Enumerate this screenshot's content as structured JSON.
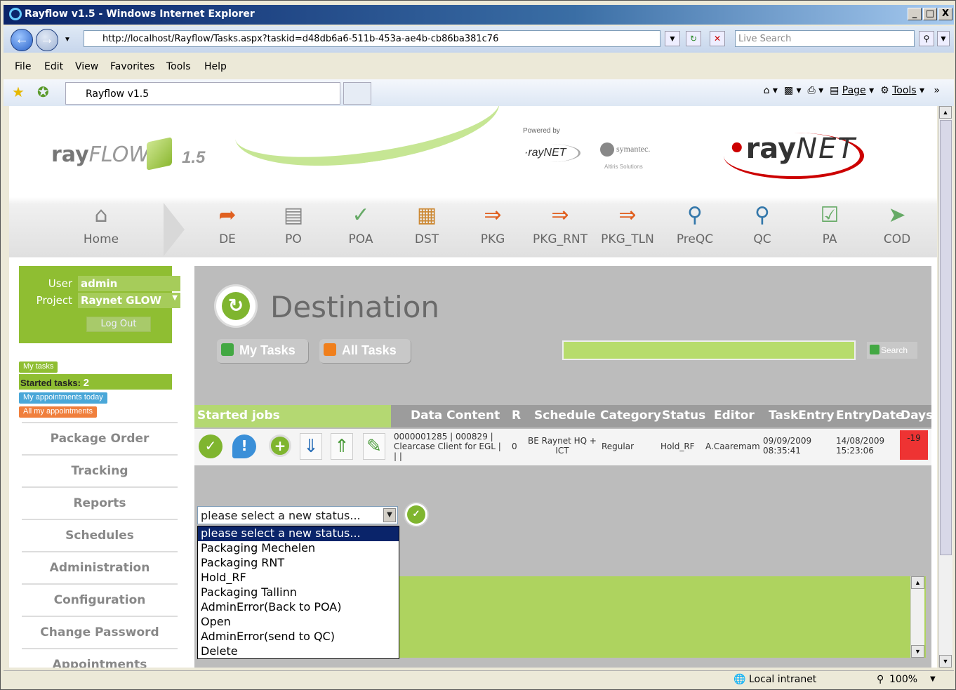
{
  "window": {
    "title": "Rayflow v1.5 - Windows Internet Explorer",
    "controls": [
      "_",
      "□",
      "X"
    ]
  },
  "addressbar": {
    "url": "http://localhost/Rayflow/Tasks.aspx?taskid=d48db6a6-511b-453a-ae4b-cb86ba381c76",
    "search_placeholder": "Live Search"
  },
  "menu": [
    "File",
    "Edit",
    "View",
    "Favorites",
    "Tools",
    "Help"
  ],
  "favbar": {
    "tab_label": "Rayflow v1.5",
    "page_label": "Page",
    "tools_label": "Tools"
  },
  "header": {
    "logo_ray": "ray",
    "logo_flow": "FLOW",
    "version": "1.5",
    "powered_by": "Powered by",
    "raynet_small": "·rayNET",
    "symantec": "symantec.",
    "altiris": "Altiris Solutions",
    "raynet_dot": "•",
    "raynet_ray": "ray",
    "raynet_net": "NET"
  },
  "nav": [
    {
      "label": "Home",
      "icon": "home-icon"
    },
    {
      "label": "DE",
      "icon": "import-icon"
    },
    {
      "label": "PO",
      "icon": "package-order-icon"
    },
    {
      "label": "POA",
      "icon": "approve-icon"
    },
    {
      "label": "DST",
      "icon": "destination-icon"
    },
    {
      "label": "PKG",
      "icon": "package-icon"
    },
    {
      "label": "PKG_RNT",
      "icon": "package-icon"
    },
    {
      "label": "PKG_TLN",
      "icon": "package-icon"
    },
    {
      "label": "PreQC",
      "icon": "magnifier-icon"
    },
    {
      "label": "QC",
      "icon": "magnifier-icon"
    },
    {
      "label": "PA",
      "icon": "checklist-icon"
    },
    {
      "label": "COD",
      "icon": "arrow-icon"
    }
  ],
  "user": {
    "user_label": "User",
    "user_value": "admin",
    "project_label": "Project",
    "project_value": "Raynet GLOW",
    "logout": "Log Out"
  },
  "mini": {
    "my_tasks": "My tasks",
    "started_tasks_label": "Started tasks:",
    "started_tasks_count": "2",
    "appointments_today": "My appointments today",
    "all_appointments": "All my appointments"
  },
  "sidebar": [
    "Package Order",
    "Tracking",
    "Reports",
    "Schedules",
    "Administration",
    "Configuration",
    "Change Password",
    "Appointments"
  ],
  "main": {
    "title": "Destination",
    "my_tasks": "My Tasks",
    "all_tasks": "All Tasks",
    "search": "Search"
  },
  "table": {
    "headers": [
      "Started jobs",
      "Data Content",
      "R",
      "Schedule",
      "Category",
      "Status",
      "Editor",
      "TaskEntry",
      "EntryDate",
      "Days"
    ],
    "row": {
      "data_content": [
        "0000001285 | 000829 |",
        "Clearcase Client for EGL |",
        "| |"
      ],
      "r": "0",
      "schedule": [
        "BE Raynet HQ +",
        "ICT"
      ],
      "category": "Regular",
      "status": "Hold_RF",
      "editor": "A.Caaremam",
      "task_entry": [
        "09/09/2009",
        "08:35:41"
      ],
      "entry_date": [
        "14/08/2009",
        "15:23:06"
      ],
      "days": "-19"
    }
  },
  "status_select": {
    "value": "please select a new status...",
    "options": [
      "please select a new status...",
      "Packaging Mechelen",
      "Packaging RNT",
      "Hold_RF",
      "Packaging Tallinn",
      "AdminError(Back to POA)",
      "Open",
      "AdminError(send to QC)",
      "Delete"
    ]
  },
  "statusbar": {
    "zone": "Local intranet",
    "zoom": "100%"
  },
  "colors": {
    "accent_green": "#8fbe32",
    "panel_gray": "#bcbcbc",
    "days_red": "#e33"
  }
}
